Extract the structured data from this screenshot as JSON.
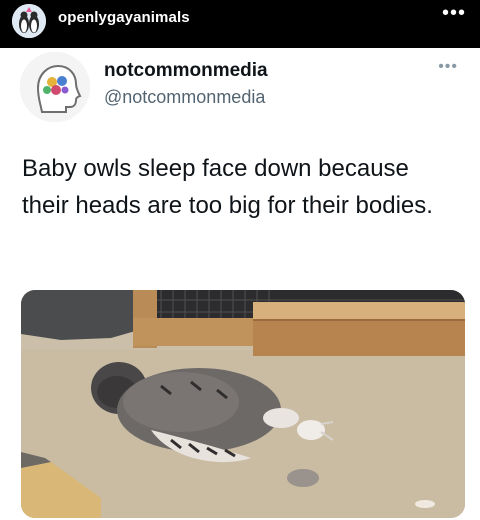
{
  "header": {
    "account_handle": "openlygayanimals",
    "avatar_icon": "penguins-avatar-icon",
    "more_icon": "more-horizontal-icon"
  },
  "tweet": {
    "avatar_icon": "head-profile-avatar-icon",
    "display_name": "notcommonmedia",
    "username": "@notcommonmedia",
    "more_icon": "more-horizontal-icon",
    "text": "Baby owls sleep face down because their heads are too big for their bodies.",
    "media_icon": "sleeping-owl-photo"
  },
  "colors": {
    "header_bg": "#000000",
    "text_primary": "#0f1419",
    "text_secondary": "#536471"
  }
}
